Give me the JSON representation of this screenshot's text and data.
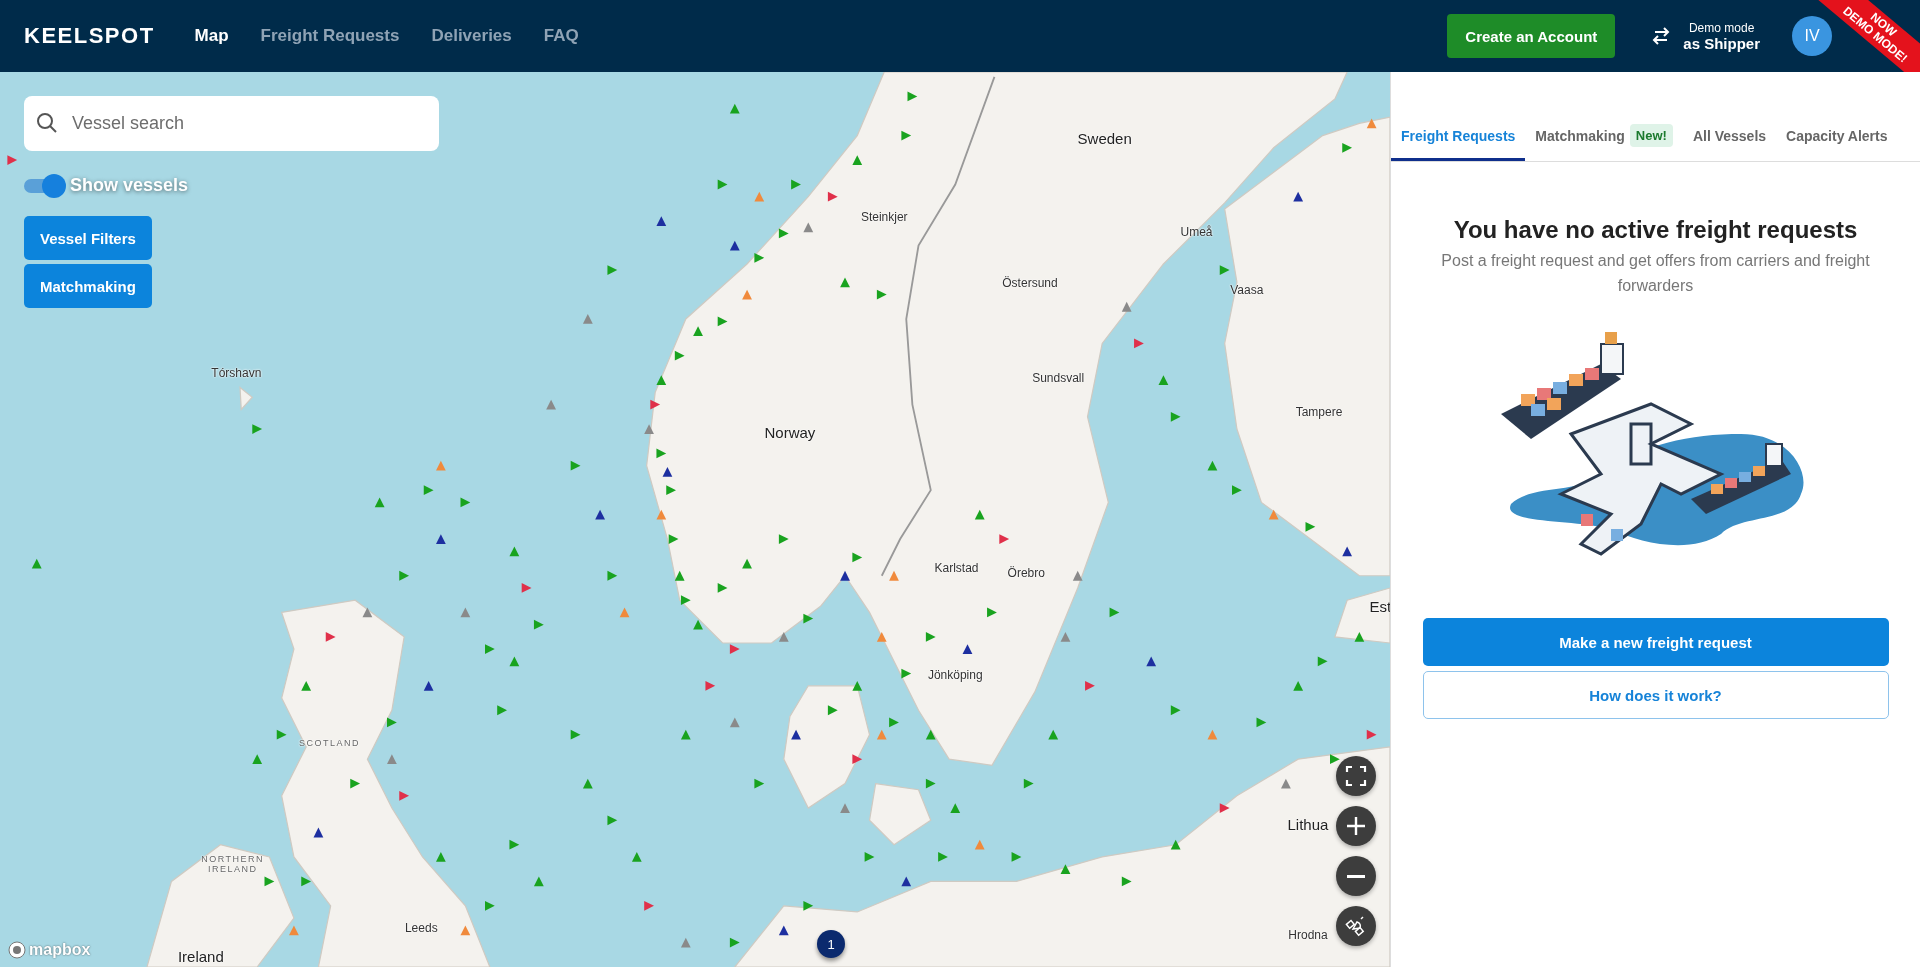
{
  "header": {
    "logo": "KEELSPOT",
    "nav": [
      {
        "label": "Map",
        "selected": true
      },
      {
        "label": "Freight Requests",
        "selected": false
      },
      {
        "label": "Deliveries",
        "selected": false
      },
      {
        "label": "FAQ",
        "selected": false
      }
    ],
    "create_account": "Create an Account",
    "demo_mode": {
      "line1": "Demo mode",
      "line2": "as Shipper"
    },
    "avatar": "IV",
    "ribbon": [
      "NOW",
      "DEMO MODE!"
    ]
  },
  "map": {
    "search": {
      "placeholder": "Vessel search"
    },
    "show_vessels": {
      "label": "Show vessels",
      "on": true
    },
    "buttons": [
      "Vessel Filters",
      "Matchmaking"
    ],
    "labels": [
      {
        "text": "Sweden",
        "kind": "country"
      },
      {
        "text": "Norway",
        "kind": "country"
      },
      {
        "text": "Steinkjer",
        "kind": "city"
      },
      {
        "text": "Östersund",
        "kind": "city"
      },
      {
        "text": "Umeå",
        "kind": "city"
      },
      {
        "text": "Vaasa",
        "kind": "city"
      },
      {
        "text": "Sundsvall",
        "kind": "city"
      },
      {
        "text": "Tórshavn",
        "kind": "city"
      },
      {
        "text": "Tampere",
        "kind": "city"
      },
      {
        "text": "Karlstad",
        "kind": "city"
      },
      {
        "text": "Örebro",
        "kind": "city"
      },
      {
        "text": "Jönköping",
        "kind": "city"
      },
      {
        "text": "SCOTLAND",
        "kind": "region"
      },
      {
        "text": "NORTHERN IRELAND",
        "kind": "region"
      },
      {
        "text": "Leeds",
        "kind": "city"
      },
      {
        "text": "Ireland",
        "kind": "country"
      },
      {
        "text": "Lithua",
        "kind": "country"
      },
      {
        "text": "Hrodna",
        "kind": "city"
      },
      {
        "text": "Est",
        "kind": "country"
      }
    ],
    "cluster": "1",
    "attribution": "mapbox"
  },
  "panel": {
    "tabs": [
      {
        "label": "Freight Requests",
        "selected": true
      },
      {
        "label": "Matchmaking",
        "badge": "New!",
        "selected": false
      },
      {
        "label": "All Vessels",
        "selected": false
      },
      {
        "label": "Capacity Alerts",
        "selected": false
      }
    ],
    "empty": {
      "title": "You have no active freight requests",
      "text": "Post a freight request and get offers from carriers and freight forwarders"
    },
    "primary_button": "Make a new freight request",
    "secondary_button": "How does it work?"
  }
}
